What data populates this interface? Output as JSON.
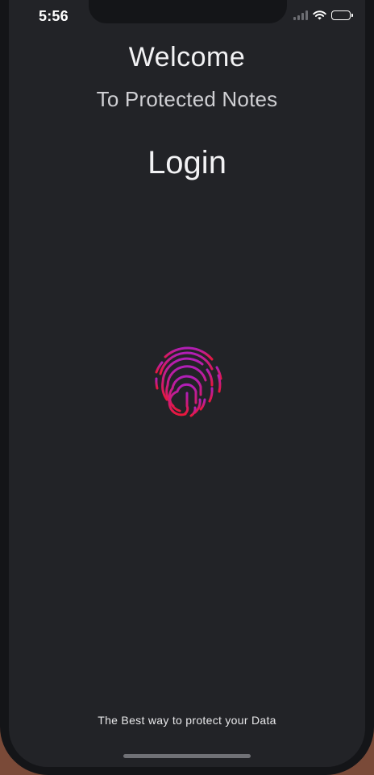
{
  "status_bar": {
    "time": "5:56",
    "icons": [
      "signal-icon",
      "wifi-icon",
      "battery-icon"
    ]
  },
  "header": {
    "title": "Welcome",
    "subtitle": "To Protected Notes"
  },
  "login": {
    "title": "Login",
    "button_icon": "fingerprint-icon",
    "gradient": [
      "#b01fb8",
      "#e8183c"
    ]
  },
  "footer": {
    "tagline": "The Best way to protect your Data"
  },
  "colors": {
    "background": "#222327",
    "text": "#ffffff"
  }
}
